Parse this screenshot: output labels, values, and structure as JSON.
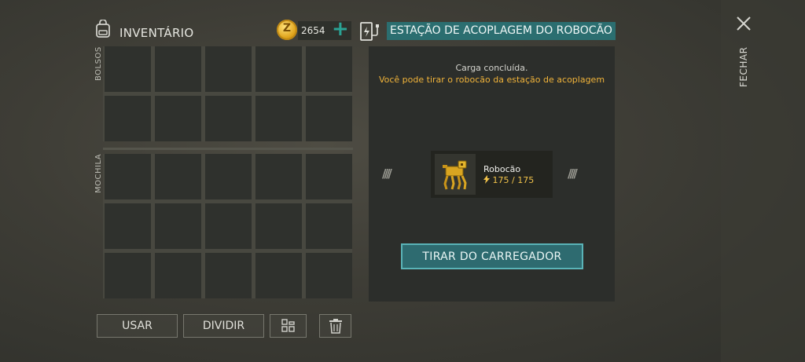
{
  "inventory": {
    "title": "INVENTÁRIO",
    "coins": "2654",
    "coin_symbol": "Z",
    "add_label": "+",
    "pockets_label": "BOLSOS",
    "backpack_label": "MOCHILA",
    "buttons": {
      "use": "USAR",
      "split": "DIVIDIR"
    }
  },
  "station": {
    "title": "ESTAÇÃO DE ACOPLAGEM DO ROBOCÃO",
    "status_line1": "Carga concluída.",
    "status_line2": "Você pode tirar o robocão da estação de acoplagem",
    "robot_name": "Robocão",
    "robot_energy": "175 / 175",
    "energy_fraction": 1.0,
    "action_button": "TIRAR DO CARREGADOR",
    "stripe_left": "////",
    "stripe_right": "////"
  },
  "close": {
    "label": "FECHAR"
  },
  "colors": {
    "accent_teal": "#2b6e70",
    "gold": "#f0b33a",
    "energy": "#f0c24a"
  },
  "icons": [
    "backpack-icon",
    "coin-icon",
    "charging-station-icon",
    "bolt-icon",
    "sort-grid-icon",
    "trash-icon",
    "close-icon"
  ]
}
